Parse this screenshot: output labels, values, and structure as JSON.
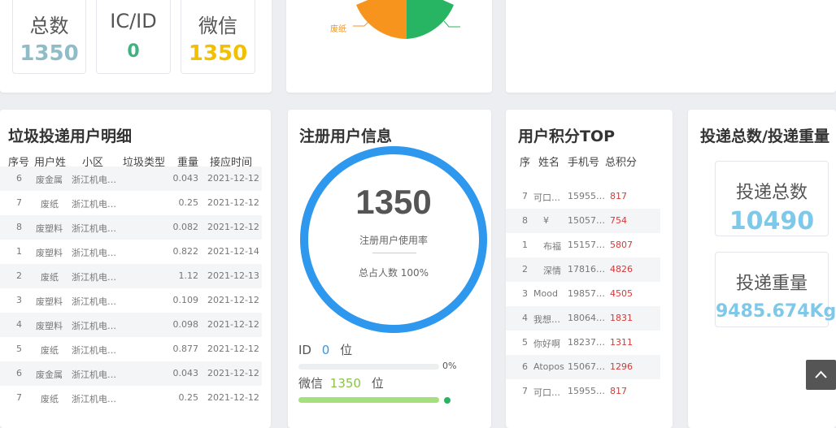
{
  "stats": {
    "total": {
      "label": "总数",
      "value": "1350",
      "color": "#8fbcc6"
    },
    "icid": {
      "label": "IC/ID",
      "value": "0",
      "color": "#3fb27f"
    },
    "wechat": {
      "label": "微信",
      "value": "1350",
      "color": "#f2c000"
    }
  },
  "pie": {
    "label_fragment": "废纸",
    "colors": [
      "#f7941d",
      "#27b463"
    ]
  },
  "records": {
    "title": "垃圾投递用户明细",
    "headers": [
      "序号",
      "用户姓",
      "小区",
      "垃圾类型",
      "重量",
      "接应时间"
    ],
    "rows": [
      [
        "6",
        "废金属",
        "浙江机电…",
        "",
        "0.043",
        "2021-12-12"
      ],
      [
        "7",
        "废纸",
        "浙江机电…",
        "",
        "0.25",
        "2021-12-12"
      ],
      [
        "8",
        "废塑料",
        "浙江机电…",
        "",
        "0.082",
        "2021-12-12"
      ],
      [
        "1",
        "废塑料",
        "浙江机电…",
        "",
        "0.822",
        "2021-12-14"
      ],
      [
        "2",
        "废纸",
        "浙江机电…",
        "",
        "1.12",
        "2021-12-13"
      ],
      [
        "3",
        "废塑料",
        "浙江机电…",
        "",
        "0.109",
        "2021-12-12"
      ],
      [
        "4",
        "废塑料",
        "浙江机电…",
        "",
        "0.098",
        "2021-12-12"
      ],
      [
        "5",
        "废纸",
        "浙江机电…",
        "",
        "0.877",
        "2021-12-12"
      ],
      [
        "6",
        "废金属",
        "浙江机电…",
        "",
        "0.043",
        "2021-12-12"
      ],
      [
        "7",
        "废纸",
        "浙江机电…",
        "",
        "0.25",
        "2021-12-12"
      ]
    ]
  },
  "registration": {
    "title": "注册用户信息",
    "count": "1350",
    "usage_label": "注册用户使用率",
    "share_label": "总占人数 100%",
    "id_label": "ID",
    "id_value": "0",
    "id_unit": "位",
    "id_percent": "0%",
    "id_fraction": 0,
    "wechat_label": "微信",
    "wechat_value": "1350",
    "wechat_unit": "位",
    "wechat_fraction": 1,
    "ring_fraction": 1,
    "ring_color": "#2e98ee",
    "bar_color": "#a6e07c",
    "wechat_value_color": "#8bc34a",
    "id_value_color": "#2e98ee"
  },
  "points": {
    "title": "用户积分TOP",
    "headers": [
      "序",
      "姓名",
      "手机号",
      "总积分"
    ],
    "rows": [
      [
        "7",
        "可口…",
        "15955…",
        "817"
      ],
      [
        "8",
        "¥",
        "15057…",
        "754"
      ],
      [
        "1",
        "布福",
        "15157…",
        "5807"
      ],
      [
        "2",
        "深情",
        "17816…",
        "4826"
      ],
      [
        "3",
        "Mood",
        "19857…",
        "4505"
      ],
      [
        "4",
        "我想…",
        "18064…",
        "1831"
      ],
      [
        "5",
        "你好啊",
        "18237…",
        "1311"
      ],
      [
        "6",
        "Atopos",
        "15067…",
        "1296"
      ],
      [
        "7",
        "可口…",
        "15955…",
        "817"
      ]
    ]
  },
  "delivery": {
    "title": "投递总数/投递重量",
    "count_label": "投递总数",
    "count_value": "10490",
    "weight_label": "投递重量",
    "weight_value": "9485.674Kg"
  }
}
